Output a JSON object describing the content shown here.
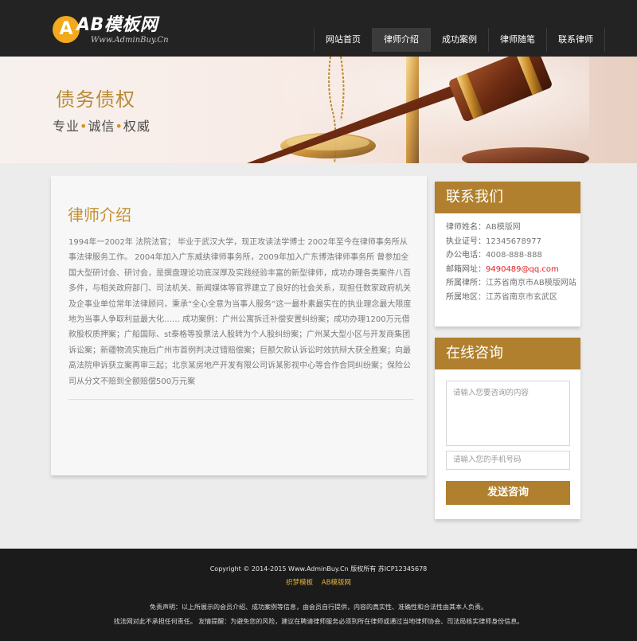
{
  "logo": {
    "mark": "A",
    "name": "AB模板网",
    "sub": "Www.AdminBuy.Cn"
  },
  "nav": {
    "items": [
      {
        "label": "网站首页"
      },
      {
        "label": "律师介绍"
      },
      {
        "label": "成功案例"
      },
      {
        "label": "律师随笔"
      },
      {
        "label": "联系律师"
      }
    ],
    "active_index": 1
  },
  "banner": {
    "title": "债务债权",
    "slogan": [
      "专业",
      "诚信",
      "权威"
    ],
    "separator": "•"
  },
  "main": {
    "title": "律师介绍",
    "text": "1994年一2002年 法院法官； 毕业于武汉大学，现正攻读法学博士 2002年至今在律师事务所从事法律服务工作。 2004年加入广东威纨律师事务所，2009年加入广东博浩律师事务所 曾参加全国大型研讨会、研讨会，是撰盘理论功底深厚及实践经验丰富的新型律师，成功办理各类案件八百多件，与相关政府部门、司法机关、新闻媒体等官界建立了良好的社会关系，现担任数家政府机关及企事业单位常年法律顾问，秉承“全心全意为当事人服务”这一最朴素最实在的执业理念最大限度地为当事人争取利益最大化……  成功案例：广州公寓拆迁补偿安置纠纷案；成功办理1200万元借款股权质押案；广船国际、st泰格等投票法人股转为个人股纠纷案；广州某大型小区与开发商集团诉讼案；新疆物流实施后广州市首例判决过错赔偿案；巨额欠款认诉讼时效抗辩大获全胜案；向最高法院申诉获立案再审三起；北京某房地产开发有限公司诉某影视中心等合作合同纠纷案；保险公司从分文不赔到全额赔偿500万元案"
  },
  "contact": {
    "title": "联系我们",
    "rows": [
      {
        "label": "律师姓名：",
        "value": "AB模版网"
      },
      {
        "label": "执业证号：",
        "value": "12345678977"
      },
      {
        "label": "办公电话：",
        "value": "4008-888-888"
      },
      {
        "label": "邮箱网址：",
        "value": "9490489@qq.com"
      },
      {
        "label": "所属律所：",
        "value": "江苏省南京市AB模版网站"
      },
      {
        "label": "所属地区：",
        "value": "江苏省南京市玄武区"
      }
    ]
  },
  "consult": {
    "title": "在线咨询",
    "content_placeholder": "请输入您要咨询的内容",
    "phone_placeholder": "请输入您的手机号码",
    "submit_label": "发送咨询"
  },
  "footer": {
    "copyright": "Copyright © 2014-2015 Www.AdminBuy.Cn 版权所有   苏ICP12345678",
    "links": [
      "织梦模板",
      "AB模版网"
    ],
    "disclaimer": "免责声明：以上所展示的会员介绍、成功案例等信息，由会员自行提供，内容的真实性、准确性和合法性由其本人负责。",
    "notice": "找法网对此不承担任何责任。   友情提醒：为避免您的风险，建议在聘请律师服务必须到所在律师或通过当地律师协会、司法局核实律师身份信息。"
  },
  "colors": {
    "accent": "#b0802f",
    "header_bg": "#232323",
    "footer_bg": "#1b1b1b",
    "link_yellow": "#e4b03a",
    "email_red": "#e02020"
  },
  "icons": [
    "logo-badge-icon",
    "gavel-and-scale-illustration"
  ]
}
